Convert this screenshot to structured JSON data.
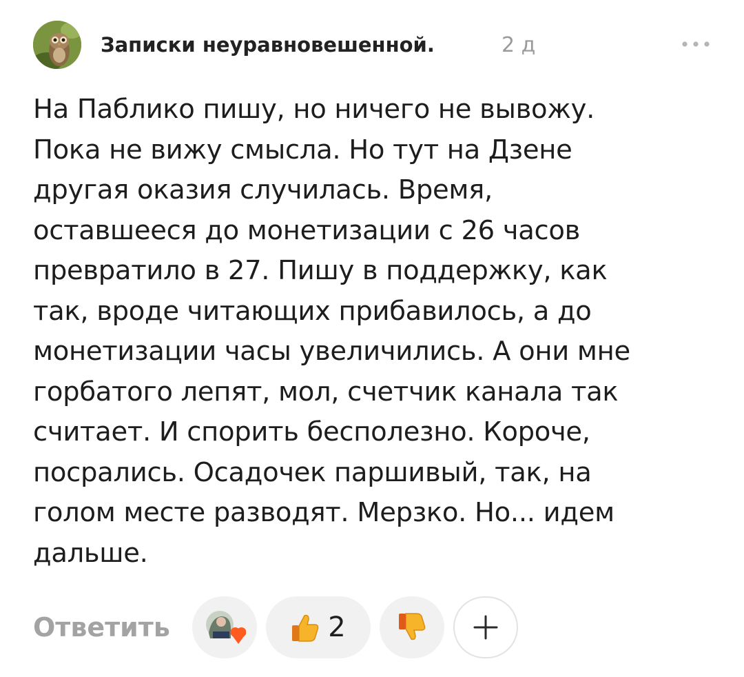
{
  "comment": {
    "author": "Записки неуравновешенной.",
    "time": "2 д",
    "avatar_icon": "owl-avatar",
    "more_icon": "more-dots-icon",
    "text": "На Паблико пишу, но ничего не вывожу.\nПока не вижу смысла. Но тут на Дзене\nдругая оказия случилась. Время,\nоставшееся до монетизации с 26 часов\nпревратило в 27. Пишу в поддержку, как\nтак, вроде читающих прибавилось, а до\nмонетизации часы увеличились. А они мне\nгорбатого лепят, мол, счетчик канала так\nсчитает. И спорить бесполезно. Короче,\nпосрались. Осадочек паршивый, так, на\nголом месте разводят. Мерзко. Но... идем\nдальше."
  },
  "actions": {
    "reply_label": "Ответить",
    "reactions_icon": "reaction-avatar-heart-icon",
    "like_icon": "thumbs-up-icon",
    "like_count": "2",
    "dislike_icon": "thumbs-down-icon",
    "add_icon": "plus-icon"
  },
  "colors": {
    "text": "#1d1d1d",
    "muted": "#9a9a9a",
    "pill_bg": "#f1f1f1",
    "heart": "#ff6a1a",
    "thumb": "#f2b530"
  }
}
